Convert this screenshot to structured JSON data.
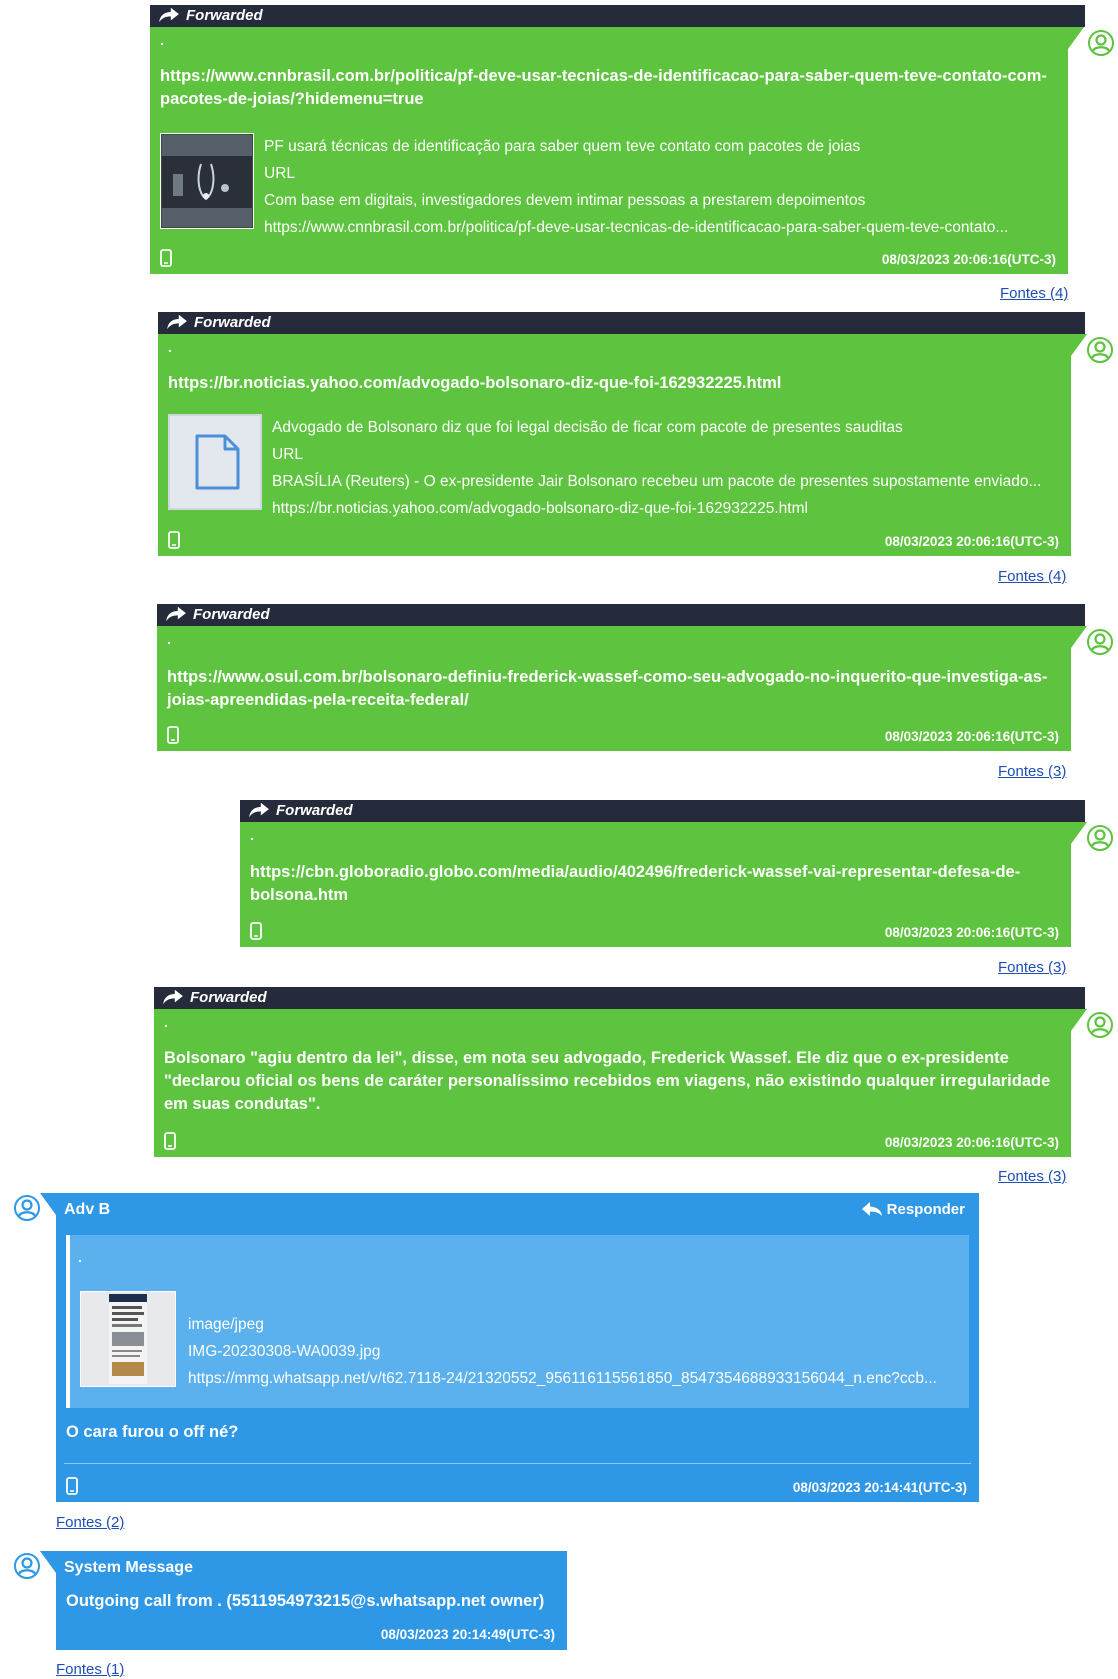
{
  "forwarded_label": "Forwarded",
  "dot": ".",
  "messages": [
    {
      "url": "https://www.cnnbrasil.com.br/politica/pf-deve-usar-tecnicas-de-identificacao-para-saber-quem-teve-contato-com-pacotes-de-joias/?hidemenu=true",
      "preview": {
        "title": "PF usará técnicas de identificação para saber quem teve contato com pacotes de joias",
        "type": "URL",
        "description": "Com base em digitais, investigadores devem intimar pessoas a prestarem depoimentos",
        "link": "https://www.cnnbrasil.com.br/politica/pf-deve-usar-tecnicas-de-identificacao-para-saber-quem-teve-contato..."
      },
      "timestamp": "08/03/2023 20:06:16(UTC-3)",
      "sources": "Fontes (4)"
    },
    {
      "url": "https://br.noticias.yahoo.com/advogado-bolsonaro-diz-que-foi-162932225.html",
      "preview": {
        "title": "Advogado de Bolsonaro diz que foi legal decisão de ficar com pacote de presentes sauditas",
        "type": "URL",
        "description": "BRASÍLIA (Reuters) - O ex-presidente Jair Bolsonaro recebeu um pacote de presentes supostamente enviado...",
        "link": "https://br.noticias.yahoo.com/advogado-bolsonaro-diz-que-foi-162932225.html"
      },
      "timestamp": "08/03/2023 20:06:16(UTC-3)",
      "sources": "Fontes (4)"
    },
    {
      "url": "https://www.osul.com.br/bolsonaro-definiu-frederick-wassef-como-seu-advogado-no-inquerito-que-investiga-as-joias-apreendidas-pela-receita-federal/",
      "timestamp": "08/03/2023 20:06:16(UTC-3)",
      "sources": "Fontes (3)"
    },
    {
      "url": "https://cbn.globoradio.globo.com/media/audio/402496/frederick-wassef-vai-representar-defesa-de-bolsona.htm",
      "timestamp": "08/03/2023 20:06:16(UTC-3)",
      "sources": "Fontes (3)"
    },
    {
      "text": "Bolsonaro \"agiu dentro da lei\", disse, em nota seu advogado, Frederick Wassef. Ele diz que o ex-presidente \"declarou oficial os bens de caráter personalíssimo recebidos em viagens, não existindo qualquer irregularidade em suas condutas\".",
      "timestamp": "08/03/2023 20:06:16(UTC-3)",
      "sources": "Fontes (3)"
    }
  ],
  "incoming": {
    "sender": "Adv B",
    "reply_label": "Responder",
    "quote": {
      "dot": ".",
      "mime": "image/jpeg",
      "filename": "IMG-20230308-WA0039.jpg",
      "url": "https://mmg.whatsapp.net/v/t62.7118-24/21320552_956116115561850_8547354688933156044_n.enc?ccb..."
    },
    "text": "O cara furou o off né?",
    "timestamp": "08/03/2023 20:14:41(UTC-3)",
    "sources": "Fontes (2)"
  },
  "system": {
    "title": "System Message",
    "text": "Outgoing call from . (5511954973215@s.whatsapp.net owner)",
    "timestamp": "08/03/2023 20:14:49(UTC-3)",
    "sources": "Fontes (1)"
  },
  "colors": {
    "outgoing": "#5ec33e",
    "incoming": "#2e97e6",
    "forwarded_bar": "#252b3a",
    "link": "#1f4fb3"
  }
}
